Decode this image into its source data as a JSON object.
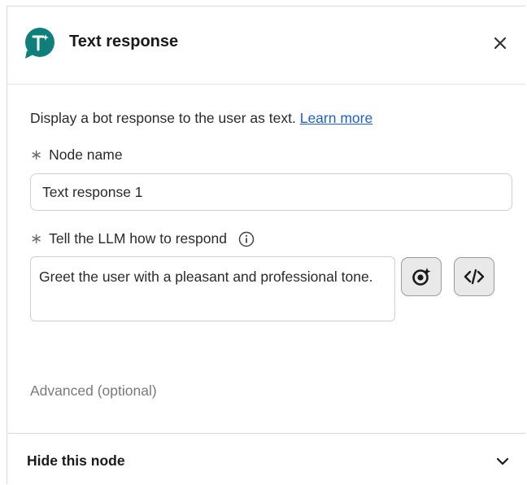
{
  "panel": {
    "title": "Text response",
    "icon": "text-response-node-icon",
    "close_icon": "close-icon"
  },
  "description": {
    "text": "Display a bot response to the user as text. ",
    "link": "Learn more"
  },
  "node_name": {
    "label": "Node name",
    "required_marker": "∗",
    "value": "Text response 1"
  },
  "llm_instruction": {
    "label": "Tell the LLM how to respond",
    "required_marker": "∗",
    "info_icon": "info-icon",
    "value": "Greet the user with a pleasant and professional tone.",
    "tools": [
      "ai-assist-icon",
      "code-icon"
    ]
  },
  "advanced": {
    "label": "Advanced (optional)"
  },
  "footer": {
    "label": "Hide this node",
    "chevron": "chevron-down-icon"
  },
  "colors": {
    "accent": "#0e7f7a",
    "link": "#1c5fd6"
  }
}
